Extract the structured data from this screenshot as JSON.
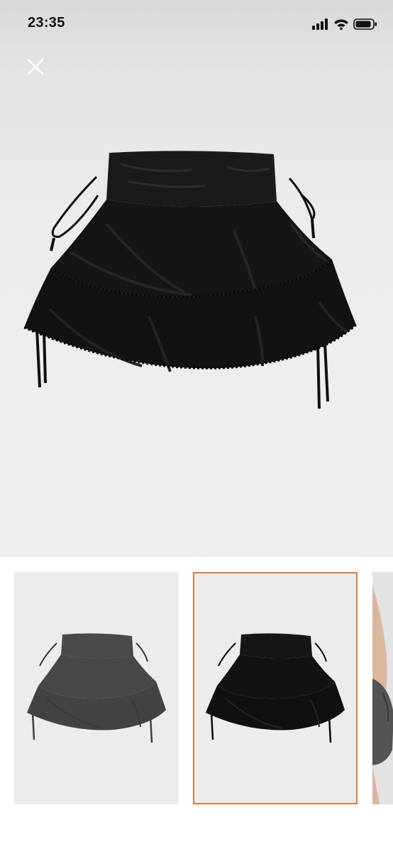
{
  "status_bar": {
    "time": "23:35",
    "icons": [
      "signal-icon",
      "wifi-icon",
      "battery-icon"
    ]
  },
  "toolbar": {
    "close_icon": "close-icon"
  },
  "gallery": {
    "selected_index": 1,
    "thumbnails": [
      {
        "color": "#4a4a4a"
      },
      {
        "color": "#121212",
        "selected": true
      },
      {
        "color": "#5a5a5a"
      }
    ],
    "accent_color": "#e07a3c"
  }
}
